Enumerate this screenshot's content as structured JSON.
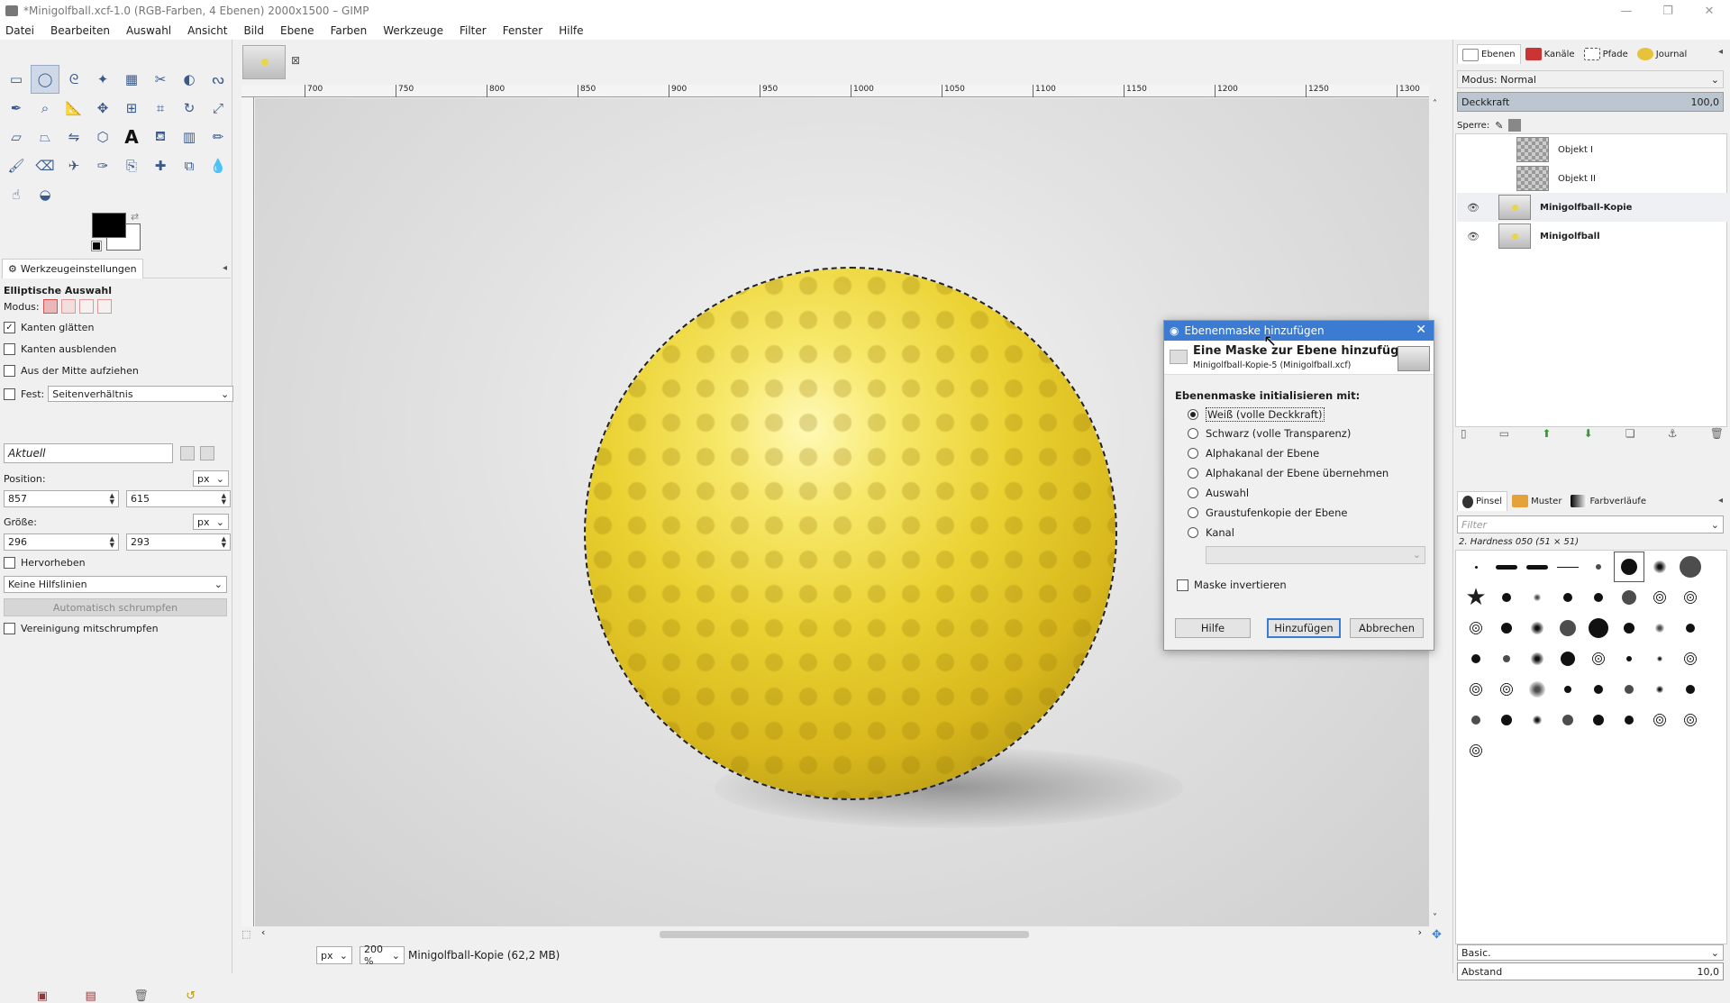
{
  "window": {
    "title": "*Minigolfball.xcf-1.0 (RGB-Farben, 4 Ebenen) 2000x1500 – GIMP"
  },
  "menu": [
    "Datei",
    "Bearbeiten",
    "Auswahl",
    "Ansicht",
    "Bild",
    "Ebene",
    "Farben",
    "Werkzeuge",
    "Filter",
    "Fenster",
    "Hilfe"
  ],
  "tool_icons": [
    "rect-select-icon",
    "ellipse-select-icon",
    "free-select-icon",
    "fuzzy-select-icon",
    "select-by-color-icon",
    "scissors-icon",
    "foreground-select-icon",
    "paths-icon",
    "color-picker-icon",
    "zoom-icon",
    "measure-icon",
    "move-icon",
    "align-icon",
    "crop-icon",
    "rotate-icon",
    "scale-icon",
    "shear-icon",
    "perspective-icon",
    "flip-icon",
    "cage-icon",
    "text-icon",
    "bucket-fill-icon",
    "gradient-icon",
    "pencil-icon",
    "paintbrush-icon",
    "eraser-icon",
    "airbrush-icon",
    "ink-icon",
    "clone-icon",
    "heal-icon",
    "perspective-clone-icon",
    "blur-icon",
    "smudge-icon",
    "dodge-burn-icon"
  ],
  "tool_options": {
    "tab_label": "Werkzeugeinstellungen",
    "tool_name": "Elliptische Auswahl",
    "mode_label": "Modus:",
    "antialias": "Kanten glätten",
    "feather": "Kanten ausblenden",
    "expand_center": "Aus der Mitte aufziehen",
    "fixed_label": "Fest:",
    "fixed_value": "Seitenverhältnis",
    "current_value": "Aktuell",
    "position_label": "Position:",
    "position_unit": "px",
    "pos_x": "857",
    "pos_y": "615",
    "size_label": "Größe:",
    "size_unit": "px",
    "size_w": "296",
    "size_h": "293",
    "highlight": "Hervorheben",
    "guides": "Keine Hilfslinien",
    "auto_shrink": "Automatisch schrumpfen",
    "shrink_merged": "Vereinigung mitschrumpfen"
  },
  "ruler": {
    "ticks": [
      "700",
      "750",
      "800",
      "850",
      "900",
      "950",
      "1000",
      "1050",
      "1100",
      "1150",
      "1200",
      "1250",
      "1300"
    ]
  },
  "statusbar": {
    "unit": "px",
    "zoom": "200 %",
    "info": "Minigolfball-Kopie (62,2 MB)"
  },
  "dock": {
    "tabs": [
      "Ebenen",
      "Kanäle",
      "Pfade",
      "Journal"
    ],
    "mode_label": "Modus: Normal",
    "opacity_label": "Deckkraft",
    "opacity_value": "100,0",
    "lock_label": "Sperre:",
    "layers": [
      {
        "name": "Objekt I",
        "visible": false,
        "bold": false
      },
      {
        "name": "Objekt II",
        "visible": false,
        "bold": false
      },
      {
        "name": "Minigolfball-Kopie",
        "visible": true,
        "bold": true
      },
      {
        "name": "Minigolfball",
        "visible": true,
        "bold": true
      }
    ],
    "brush_tabs": [
      "Pinsel",
      "Muster",
      "Farbverläufe"
    ],
    "filter_placeholder": "Filter",
    "brush_name": "2. Hardness 050 (51 × 51)",
    "preset": "Basic.",
    "spacing_label": "Abstand",
    "spacing_value": "10,0"
  },
  "dialog": {
    "title": "Ebenenmaske hinzufügen",
    "heading": "Eine Maske zur Ebene hinzufügen",
    "subheading": "Minigolfball-Kopie-5 (Minigolfball.xcf)",
    "section": "Ebenenmaske initialisieren mit:",
    "options": [
      "Weiß (volle Deckkraft)",
      "Schwarz (volle Transparenz)",
      "Alphakanal der Ebene",
      "Alphakanal der Ebene übernehmen",
      "Auswahl",
      "Graustufenkopie der Ebene",
      "Kanal"
    ],
    "selected_index": 0,
    "invert": "Maske invertieren",
    "btn_help": "Hilfe",
    "btn_add": "Hinzufügen",
    "btn_cancel": "Abbrechen"
  }
}
